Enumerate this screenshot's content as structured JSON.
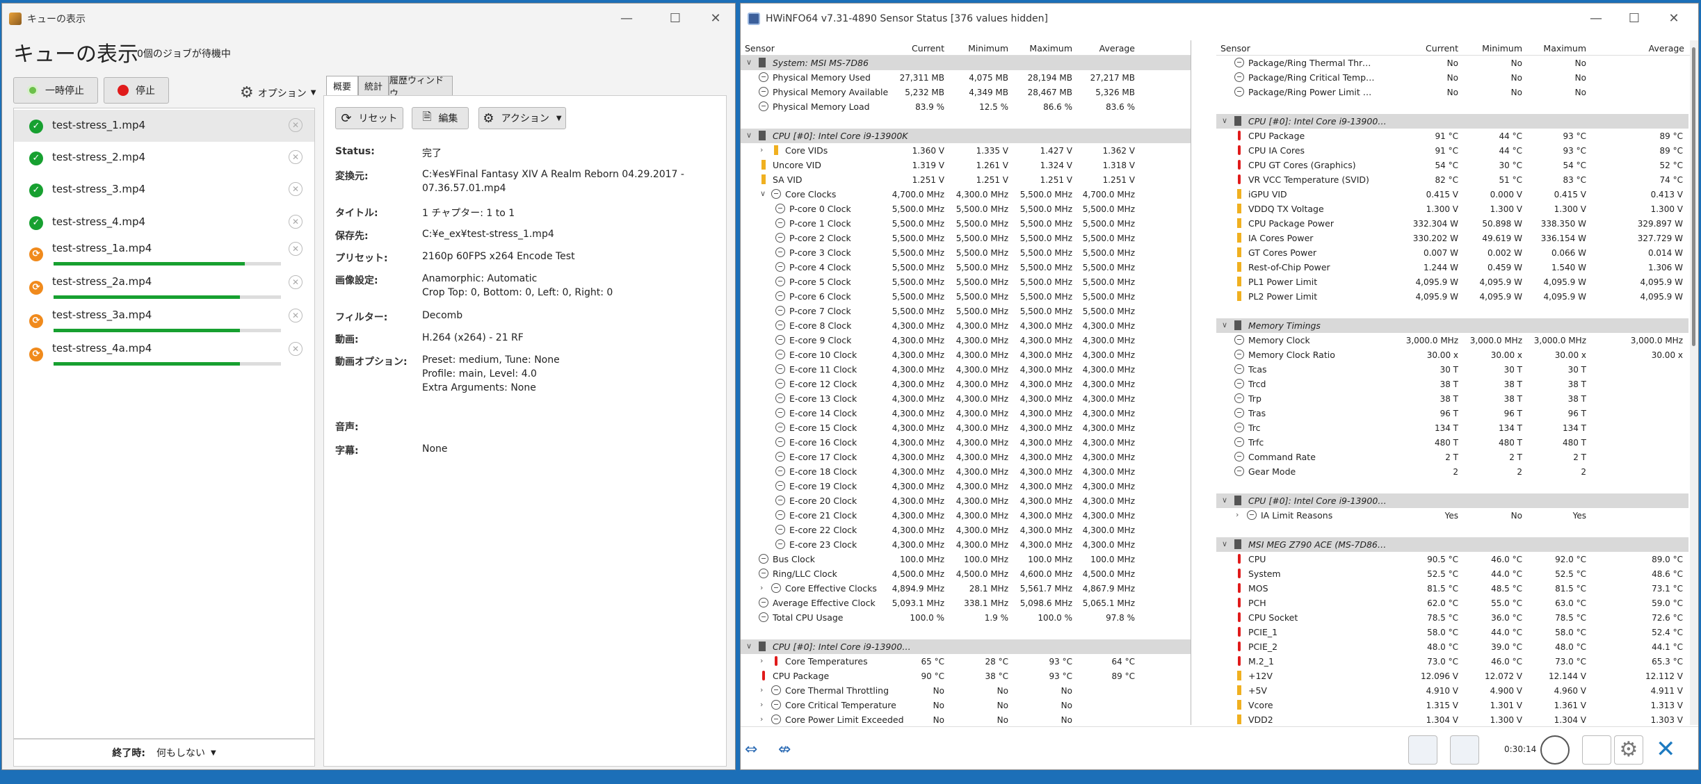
{
  "handbrake": {
    "title": "キューの表示",
    "heading": "キューの表示",
    "waiting": "0個のジョブが待機中",
    "pause_label": "一時停止",
    "stop_label": "停止",
    "options_label": "オプション",
    "queue": [
      {
        "name": "test-stress_1.mp4",
        "status": "done"
      },
      {
        "name": "test-stress_2.mp4",
        "status": "done"
      },
      {
        "name": "test-stress_3.mp4",
        "status": "done"
      },
      {
        "name": "test-stress_4.mp4",
        "status": "done"
      },
      {
        "name": "test-stress_1a.mp4",
        "status": "encoding",
        "progress": 0.84
      },
      {
        "name": "test-stress_2a.mp4",
        "status": "encoding",
        "progress": 0.82
      },
      {
        "name": "test-stress_3a.mp4",
        "status": "encoding",
        "progress": 0.82
      },
      {
        "name": "test-stress_4a.mp4",
        "status": "encoding",
        "progress": 0.82
      }
    ],
    "on_done_label": "終了時:",
    "on_done_value": "何もしない",
    "tabs": [
      "概要",
      "統計",
      "履歴ウィンドウ"
    ],
    "reset_label": "リセット",
    "edit_label": "編集",
    "action_label": "アクション",
    "details": {
      "status_label": "Status:",
      "status_value": "完了",
      "source_label": "変換元:",
      "source_value_1": "C:¥es¥Final Fantasy XIV  A Realm Reborn 04.29.2017 -",
      "source_value_2": "07.36.57.01.mp4",
      "title_label": "タイトル:",
      "title_value": "1   チャプター: 1  to  1",
      "dest_label": "保存先:",
      "dest_value": "C:¥e_ex¥test-stress_1.mp4",
      "preset_label": "プリセット:",
      "preset_value": "2160p 60FPS x264 Encode Test",
      "picture_label": "画像設定:",
      "picture_value_1": "Anamorphic: Automatic",
      "picture_value_2": "Crop Top: 0, Bottom: 0, Left: 0, Right: 0",
      "filter_label": "フィルター:",
      "filter_value": "Decomb",
      "video_label": "動画:",
      "video_value": "H.264 (x264) - 21 RF",
      "videoopt_label": "動画オプション:",
      "videoopt_value_1": "Preset: medium, Tune: None",
      "videoopt_value_2": "Profile: main, Level: 4.0",
      "videoopt_value_3": "Extra Arguments: None",
      "audio_label": "音声:",
      "subs_label": "字幕:",
      "subs_value": "None"
    }
  },
  "hwinfo": {
    "title": "HWiNFO64 v7.31-4890 Sensor Status [376 values hidden]",
    "columns": [
      "Sensor",
      "Current",
      "Minimum",
      "Maximum",
      "Average"
    ],
    "time": "0:30:14",
    "left_rows": [
      {
        "t": "g",
        "n": "System: MSI MS-7D86"
      },
      {
        "n": "Physical Memory Used",
        "i": "c",
        "v": [
          "27,311 MB",
          "4,075 MB",
          "28,194 MB",
          "27,217 MB"
        ]
      },
      {
        "n": "Physical Memory Available",
        "i": "c",
        "v": [
          "5,232 MB",
          "4,349 MB",
          "28,467 MB",
          "5,326 MB"
        ]
      },
      {
        "n": "Physical Memory Load",
        "i": "c",
        "v": [
          "83.9 %",
          "12.5 %",
          "86.6 %",
          "83.6 %"
        ]
      },
      {
        "t": "s"
      },
      {
        "t": "g",
        "n": "CPU [#0]: Intel Core i9-13900K"
      },
      {
        "n": "Core VIDs",
        "i": "b",
        "e": ">",
        "v": [
          "1.360 V",
          "1.335 V",
          "1.427 V",
          "1.362 V"
        ]
      },
      {
        "n": "Uncore VID",
        "i": "b",
        "v": [
          "1.319 V",
          "1.261 V",
          "1.324 V",
          "1.318 V"
        ]
      },
      {
        "n": "SA VID",
        "i": "b",
        "v": [
          "1.251 V",
          "1.251 V",
          "1.251 V",
          "1.251 V"
        ]
      },
      {
        "n": "Core Clocks",
        "i": "c",
        "e": "v",
        "v": [
          "4,700.0 MHz",
          "4,300.0 MHz",
          "5,500.0 MHz",
          "4,700.0 MHz"
        ]
      },
      {
        "n": "P-core 0 Clock",
        "i": "c",
        "d": 2,
        "v": [
          "5,500.0 MHz",
          "5,500.0 MHz",
          "5,500.0 MHz",
          "5,500.0 MHz"
        ]
      },
      {
        "n": "P-core 1 Clock",
        "i": "c",
        "d": 2,
        "v": [
          "5,500.0 MHz",
          "5,500.0 MHz",
          "5,500.0 MHz",
          "5,500.0 MHz"
        ]
      },
      {
        "n": "P-core 2 Clock",
        "i": "c",
        "d": 2,
        "v": [
          "5,500.0 MHz",
          "5,500.0 MHz",
          "5,500.0 MHz",
          "5,500.0 MHz"
        ]
      },
      {
        "n": "P-core 3 Clock",
        "i": "c",
        "d": 2,
        "v": [
          "5,500.0 MHz",
          "5,500.0 MHz",
          "5,500.0 MHz",
          "5,500.0 MHz"
        ]
      },
      {
        "n": "P-core 4 Clock",
        "i": "c",
        "d": 2,
        "v": [
          "5,500.0 MHz",
          "5,500.0 MHz",
          "5,500.0 MHz",
          "5,500.0 MHz"
        ]
      },
      {
        "n": "P-core 5 Clock",
        "i": "c",
        "d": 2,
        "v": [
          "5,500.0 MHz",
          "5,500.0 MHz",
          "5,500.0 MHz",
          "5,500.0 MHz"
        ]
      },
      {
        "n": "P-core 6 Clock",
        "i": "c",
        "d": 2,
        "v": [
          "5,500.0 MHz",
          "5,500.0 MHz",
          "5,500.0 MHz",
          "5,500.0 MHz"
        ]
      },
      {
        "n": "P-core 7 Clock",
        "i": "c",
        "d": 2,
        "v": [
          "5,500.0 MHz",
          "5,500.0 MHz",
          "5,500.0 MHz",
          "5,500.0 MHz"
        ]
      },
      {
        "n": "E-core 8 Clock",
        "i": "c",
        "d": 2,
        "v": [
          "4,300.0 MHz",
          "4,300.0 MHz",
          "4,300.0 MHz",
          "4,300.0 MHz"
        ]
      },
      {
        "n": "E-core 9 Clock",
        "i": "c",
        "d": 2,
        "v": [
          "4,300.0 MHz",
          "4,300.0 MHz",
          "4,300.0 MHz",
          "4,300.0 MHz"
        ]
      },
      {
        "n": "E-core 10 Clock",
        "i": "c",
        "d": 2,
        "v": [
          "4,300.0 MHz",
          "4,300.0 MHz",
          "4,300.0 MHz",
          "4,300.0 MHz"
        ]
      },
      {
        "n": "E-core 11 Clock",
        "i": "c",
        "d": 2,
        "v": [
          "4,300.0 MHz",
          "4,300.0 MHz",
          "4,300.0 MHz",
          "4,300.0 MHz"
        ]
      },
      {
        "n": "E-core 12 Clock",
        "i": "c",
        "d": 2,
        "v": [
          "4,300.0 MHz",
          "4,300.0 MHz",
          "4,300.0 MHz",
          "4,300.0 MHz"
        ]
      },
      {
        "n": "E-core 13 Clock",
        "i": "c",
        "d": 2,
        "v": [
          "4,300.0 MHz",
          "4,300.0 MHz",
          "4,300.0 MHz",
          "4,300.0 MHz"
        ]
      },
      {
        "n": "E-core 14 Clock",
        "i": "c",
        "d": 2,
        "v": [
          "4,300.0 MHz",
          "4,300.0 MHz",
          "4,300.0 MHz",
          "4,300.0 MHz"
        ]
      },
      {
        "n": "E-core 15 Clock",
        "i": "c",
        "d": 2,
        "v": [
          "4,300.0 MHz",
          "4,300.0 MHz",
          "4,300.0 MHz",
          "4,300.0 MHz"
        ]
      },
      {
        "n": "E-core 16 Clock",
        "i": "c",
        "d": 2,
        "v": [
          "4,300.0 MHz",
          "4,300.0 MHz",
          "4,300.0 MHz",
          "4,300.0 MHz"
        ]
      },
      {
        "n": "E-core 17 Clock",
        "i": "c",
        "d": 2,
        "v": [
          "4,300.0 MHz",
          "4,300.0 MHz",
          "4,300.0 MHz",
          "4,300.0 MHz"
        ]
      },
      {
        "n": "E-core 18 Clock",
        "i": "c",
        "d": 2,
        "v": [
          "4,300.0 MHz",
          "4,300.0 MHz",
          "4,300.0 MHz",
          "4,300.0 MHz"
        ]
      },
      {
        "n": "E-core 19 Clock",
        "i": "c",
        "d": 2,
        "v": [
          "4,300.0 MHz",
          "4,300.0 MHz",
          "4,300.0 MHz",
          "4,300.0 MHz"
        ]
      },
      {
        "n": "E-core 20 Clock",
        "i": "c",
        "d": 2,
        "v": [
          "4,300.0 MHz",
          "4,300.0 MHz",
          "4,300.0 MHz",
          "4,300.0 MHz"
        ]
      },
      {
        "n": "E-core 21 Clock",
        "i": "c",
        "d": 2,
        "v": [
          "4,300.0 MHz",
          "4,300.0 MHz",
          "4,300.0 MHz",
          "4,300.0 MHz"
        ]
      },
      {
        "n": "E-core 22 Clock",
        "i": "c",
        "d": 2,
        "v": [
          "4,300.0 MHz",
          "4,300.0 MHz",
          "4,300.0 MHz",
          "4,300.0 MHz"
        ]
      },
      {
        "n": "E-core 23 Clock",
        "i": "c",
        "d": 2,
        "v": [
          "4,300.0 MHz",
          "4,300.0 MHz",
          "4,300.0 MHz",
          "4,300.0 MHz"
        ]
      },
      {
        "n": "Bus Clock",
        "i": "c",
        "v": [
          "100.0 MHz",
          "100.0 MHz",
          "100.0 MHz",
          "100.0 MHz"
        ]
      },
      {
        "n": "Ring/LLC Clock",
        "i": "c",
        "v": [
          "4,500.0 MHz",
          "4,500.0 MHz",
          "4,600.0 MHz",
          "4,500.0 MHz"
        ]
      },
      {
        "n": "Core Effective Clocks",
        "i": "c",
        "e": ">",
        "v": [
          "4,894.9 MHz",
          "28.1 MHz",
          "5,561.7 MHz",
          "4,867.9 MHz"
        ]
      },
      {
        "n": "Average Effective Clock",
        "i": "c",
        "v": [
          "5,093.1 MHz",
          "338.1 MHz",
          "5,098.6 MHz",
          "5,065.1 MHz"
        ]
      },
      {
        "n": "Total CPU Usage",
        "i": "c",
        "v": [
          "100.0 %",
          "1.9 %",
          "100.0 %",
          "97.8 %"
        ]
      },
      {
        "t": "s"
      },
      {
        "t": "g",
        "n": "CPU [#0]: Intel Core i9-13900K:..."
      },
      {
        "n": "Core Temperatures",
        "i": "t",
        "e": ">",
        "v": [
          "65 °C",
          "28 °C",
          "93 °C",
          "64 °C"
        ]
      },
      {
        "n": "CPU Package",
        "i": "t",
        "v": [
          "90 °C",
          "38 °C",
          "93 °C",
          "89 °C"
        ]
      },
      {
        "n": "Core Thermal Throttling",
        "i": "c",
        "e": ">",
        "v": [
          "No",
          "No",
          "No",
          ""
        ]
      },
      {
        "n": "Core Critical Temperature",
        "i": "c",
        "e": ">",
        "v": [
          "No",
          "No",
          "No",
          ""
        ]
      },
      {
        "n": "Core Power Limit Exceeded",
        "i": "c",
        "e": ">",
        "v": [
          "No",
          "No",
          "No",
          ""
        ]
      }
    ],
    "right_rows": [
      {
        "n": "Package/Ring Thermal Throttling",
        "i": "c",
        "v": [
          "No",
          "No",
          "No",
          ""
        ]
      },
      {
        "n": "Package/Ring Critical Temperat...",
        "i": "c",
        "v": [
          "No",
          "No",
          "No",
          ""
        ]
      },
      {
        "n": "Package/Ring Power Limit Excee...",
        "i": "c",
        "v": [
          "No",
          "No",
          "No",
          ""
        ]
      },
      {
        "t": "s"
      },
      {
        "t": "g",
        "n": "CPU [#0]: Intel Core i9-13900K:..."
      },
      {
        "n": "CPU Package",
        "i": "t",
        "v": [
          "91 °C",
          "44 °C",
          "93 °C",
          "89 °C"
        ]
      },
      {
        "n": "CPU IA Cores",
        "i": "t",
        "v": [
          "91 °C",
          "44 °C",
          "93 °C",
          "89 °C"
        ]
      },
      {
        "n": "CPU GT Cores (Graphics)",
        "i": "t",
        "v": [
          "54 °C",
          "30 °C",
          "54 °C",
          "52 °C"
        ]
      },
      {
        "n": "VR VCC Temperature (SVID)",
        "i": "t",
        "v": [
          "82 °C",
          "51 °C",
          "83 °C",
          "74 °C"
        ]
      },
      {
        "n": "iGPU VID",
        "i": "b",
        "v": [
          "0.415 V",
          "0.000 V",
          "0.415 V",
          "0.413 V"
        ]
      },
      {
        "n": "VDDQ TX Voltage",
        "i": "b",
        "v": [
          "1.300 V",
          "1.300 V",
          "1.300 V",
          "1.300 V"
        ]
      },
      {
        "n": "CPU Package Power",
        "i": "b",
        "v": [
          "332.304 W",
          "50.898 W",
          "338.350 W",
          "329.897 W"
        ]
      },
      {
        "n": "IA Cores Power",
        "i": "b",
        "v": [
          "330.202 W",
          "49.619 W",
          "336.154 W",
          "327.729 W"
        ]
      },
      {
        "n": "GT Cores Power",
        "i": "b",
        "v": [
          "0.007 W",
          "0.002 W",
          "0.066 W",
          "0.014 W"
        ]
      },
      {
        "n": "Rest-of-Chip Power",
        "i": "b",
        "v": [
          "1.244 W",
          "0.459 W",
          "1.540 W",
          "1.306 W"
        ]
      },
      {
        "n": "PL1 Power Limit",
        "i": "b",
        "v": [
          "4,095.9 W",
          "4,095.9 W",
          "4,095.9 W",
          "4,095.9 W"
        ]
      },
      {
        "n": "PL2 Power Limit",
        "i": "b",
        "v": [
          "4,095.9 W",
          "4,095.9 W",
          "4,095.9 W",
          "4,095.9 W"
        ]
      },
      {
        "t": "s"
      },
      {
        "t": "g",
        "n": "Memory Timings"
      },
      {
        "n": "Memory Clock",
        "i": "c",
        "v": [
          "3,000.0 MHz",
          "3,000.0 MHz",
          "3,000.0 MHz",
          "3,000.0 MHz"
        ]
      },
      {
        "n": "Memory Clock Ratio",
        "i": "c",
        "v": [
          "30.00 x",
          "30.00 x",
          "30.00 x",
          "30.00 x"
        ]
      },
      {
        "n": "Tcas",
        "i": "c",
        "v": [
          "30 T",
          "30 T",
          "30 T",
          ""
        ]
      },
      {
        "n": "Trcd",
        "i": "c",
        "v": [
          "38 T",
          "38 T",
          "38 T",
          ""
        ]
      },
      {
        "n": "Trp",
        "i": "c",
        "v": [
          "38 T",
          "38 T",
          "38 T",
          ""
        ]
      },
      {
        "n": "Tras",
        "i": "c",
        "v": [
          "96 T",
          "96 T",
          "96 T",
          ""
        ]
      },
      {
        "n": "Trc",
        "i": "c",
        "v": [
          "134 T",
          "134 T",
          "134 T",
          ""
        ]
      },
      {
        "n": "Trfc",
        "i": "c",
        "v": [
          "480 T",
          "480 T",
          "480 T",
          ""
        ]
      },
      {
        "n": "Command Rate",
        "i": "c",
        "v": [
          "2 T",
          "2 T",
          "2 T",
          ""
        ]
      },
      {
        "n": "Gear Mode",
        "i": "c",
        "v": [
          "2",
          "2",
          "2",
          ""
        ]
      },
      {
        "t": "s"
      },
      {
        "t": "g",
        "n": "CPU [#0]: Intel Core i9-13900K:..."
      },
      {
        "n": "IA Limit Reasons",
        "i": "c",
        "e": ">",
        "v": [
          "Yes",
          "No",
          "Yes",
          ""
        ]
      },
      {
        "t": "s"
      },
      {
        "t": "g",
        "n": "MSI MEG Z790 ACE (MS-7D86) (..."
      },
      {
        "n": "CPU",
        "i": "t",
        "v": [
          "90.5 °C",
          "46.0 °C",
          "92.0 °C",
          "89.0 °C"
        ]
      },
      {
        "n": "System",
        "i": "t",
        "v": [
          "52.5 °C",
          "44.0 °C",
          "52.5 °C",
          "48.6 °C"
        ]
      },
      {
        "n": "MOS",
        "i": "t",
        "v": [
          "81.5 °C",
          "48.5 °C",
          "81.5 °C",
          "73.1 °C"
        ]
      },
      {
        "n": "PCH",
        "i": "t",
        "v": [
          "62.0 °C",
          "55.0 °C",
          "63.0 °C",
          "59.0 °C"
        ]
      },
      {
        "n": "CPU Socket",
        "i": "t",
        "v": [
          "78.5 °C",
          "36.0 °C",
          "78.5 °C",
          "72.6 °C"
        ]
      },
      {
        "n": "PCIE_1",
        "i": "t",
        "v": [
          "58.0 °C",
          "44.0 °C",
          "58.0 °C",
          "52.4 °C"
        ]
      },
      {
        "n": "PCIE_2",
        "i": "t",
        "v": [
          "48.0 °C",
          "39.0 °C",
          "48.0 °C",
          "44.1 °C"
        ]
      },
      {
        "n": "M.2_1",
        "i": "t",
        "v": [
          "73.0 °C",
          "46.0 °C",
          "73.0 °C",
          "65.3 °C"
        ]
      },
      {
        "n": "+12V",
        "i": "b",
        "v": [
          "12.096 V",
          "12.072 V",
          "12.144 V",
          "12.112 V"
        ]
      },
      {
        "n": "+5V",
        "i": "b",
        "v": [
          "4.910 V",
          "4.900 V",
          "4.960 V",
          "4.911 V"
        ]
      },
      {
        "n": "Vcore",
        "i": "b",
        "v": [
          "1.315 V",
          "1.301 V",
          "1.361 V",
          "1.313 V"
        ]
      },
      {
        "n": "VDD2",
        "i": "b",
        "v": [
          "1.304 V",
          "1.300 V",
          "1.304 V",
          "1.303 V"
        ]
      }
    ]
  },
  "colors": {
    "green": "#17a030",
    "orange": "#f08a1c",
    "red": "#e01b1b",
    "group_bg": "#d9d9d9"
  }
}
